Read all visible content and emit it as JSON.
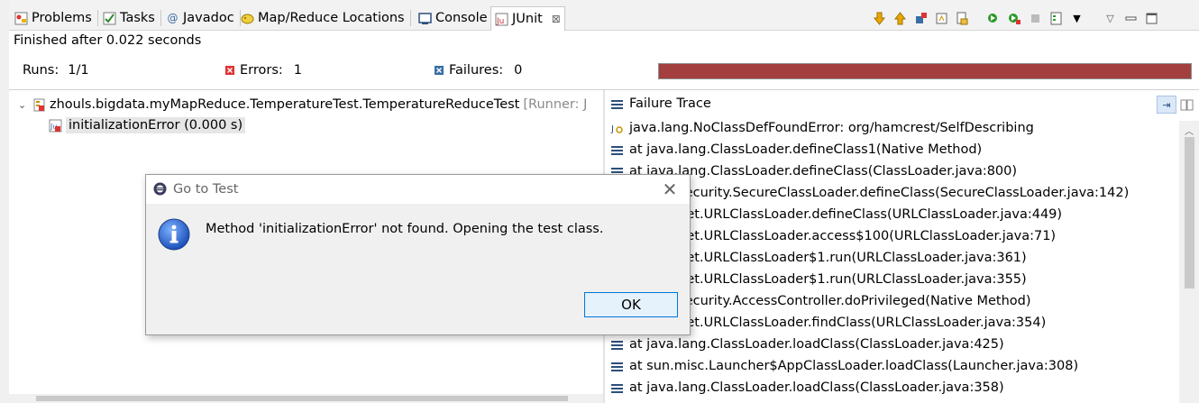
{
  "tabs": [
    {
      "label": "Problems",
      "icon": "problems-icon"
    },
    {
      "label": "Tasks",
      "icon": "tasks-icon"
    },
    {
      "label": "Javadoc",
      "icon": "javadoc-icon"
    },
    {
      "label": "Map/Reduce Locations",
      "icon": "map-reduce-icon"
    },
    {
      "label": "Console",
      "icon": "console-icon"
    },
    {
      "label": "JUnit",
      "icon": "junit-icon",
      "active": true
    }
  ],
  "junit": {
    "status": "Finished after 0.022 seconds",
    "runs_label": "Runs:",
    "runs_value": "1/1",
    "errors_label": "Errors:",
    "errors_value": "1",
    "failures_label": "Failures:",
    "failures_value": "0",
    "progress_color": "#a3403f",
    "progress_fraction": 1.0
  },
  "tree": {
    "root_label": "zhouls.bigdata.myMapReduce.TemperatureTest.TemperatureReduceTest",
    "root_runner": "[Runner: J",
    "child_label": "initializationError (0.000 s)"
  },
  "trace": {
    "title": "Failure Trace",
    "lines": [
      "java.lang.NoClassDefFoundError: org/hamcrest/SelfDescribing",
      "at java.lang.ClassLoader.defineClass1(Native Method)",
      "at java.lang.ClassLoader.defineClass(ClassLoader.java:800)",
      "at java.security.SecureClassLoader.defineClass(SecureClassLoader.java:142)",
      "at java.net.URLClassLoader.defineClass(URLClassLoader.java:449)",
      "at java.net.URLClassLoader.access$100(URLClassLoader.java:71)",
      "at java.net.URLClassLoader$1.run(URLClassLoader.java:361)",
      "at java.net.URLClassLoader$1.run(URLClassLoader.java:355)",
      "at java.security.AccessController.doPrivileged(Native Method)",
      "at java.net.URLClassLoader.findClass(URLClassLoader.java:354)",
      "at java.lang.ClassLoader.loadClass(ClassLoader.java:425)",
      "at sun.misc.Launcher$AppClassLoader.loadClass(Launcher.java:308)",
      "at java.lang.ClassLoader.loadClass(ClassLoader.java:358)"
    ]
  },
  "dialog": {
    "title": "Go to Test",
    "message": "Method 'initializationError' not found. Opening the test class.",
    "ok_label": "OK"
  }
}
